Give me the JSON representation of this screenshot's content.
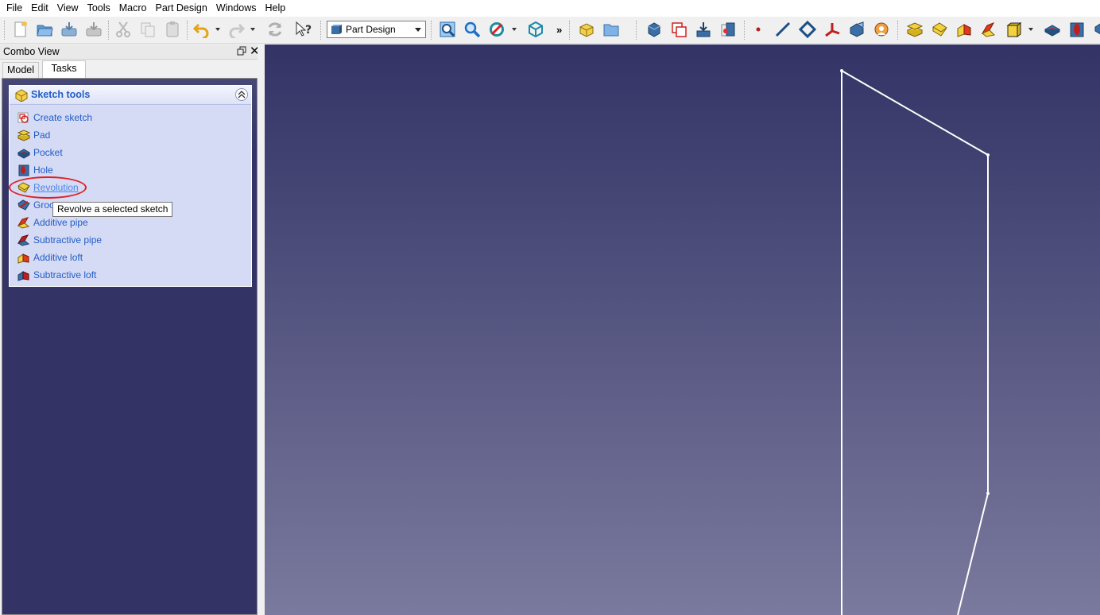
{
  "menu": [
    "File",
    "Edit",
    "View",
    "Tools",
    "Macro",
    "Part Design",
    "Windows",
    "Help"
  ],
  "toolbar": {
    "workbench": "Part Design",
    "more": "»"
  },
  "combo_view": {
    "title": "Combo View",
    "tabs": [
      "Model",
      "Tasks"
    ],
    "active_tab": "Tasks"
  },
  "task_panel": {
    "title": "Sketch tools",
    "items": [
      {
        "label": "Create sketch",
        "icon": "sketch-icon"
      },
      {
        "label": "Pad",
        "icon": "pad-icon"
      },
      {
        "label": "Pocket",
        "icon": "pocket-icon"
      },
      {
        "label": "Hole",
        "icon": "hole-icon"
      },
      {
        "label": "Revolution",
        "icon": "revolution-icon"
      },
      {
        "label": "Groove",
        "icon": "groove-icon"
      },
      {
        "label": "Additive pipe",
        "icon": "additive-pipe-icon"
      },
      {
        "label": "Subtractive pipe",
        "icon": "subtractive-pipe-icon"
      },
      {
        "label": "Additive loft",
        "icon": "additive-loft-icon"
      },
      {
        "label": "Subtractive loft",
        "icon": "subtractive-loft-icon"
      }
    ],
    "hovered_item": "Revolution"
  },
  "tooltip": "Revolve a selected sketch",
  "colors": {
    "link": "#215dc6",
    "link_hover": "#4b86e6",
    "annotation": "#e02020",
    "view_bg_top": "#333366",
    "view_bg_bottom": "#7a7a9e",
    "sketch_line": "#ffffff"
  }
}
